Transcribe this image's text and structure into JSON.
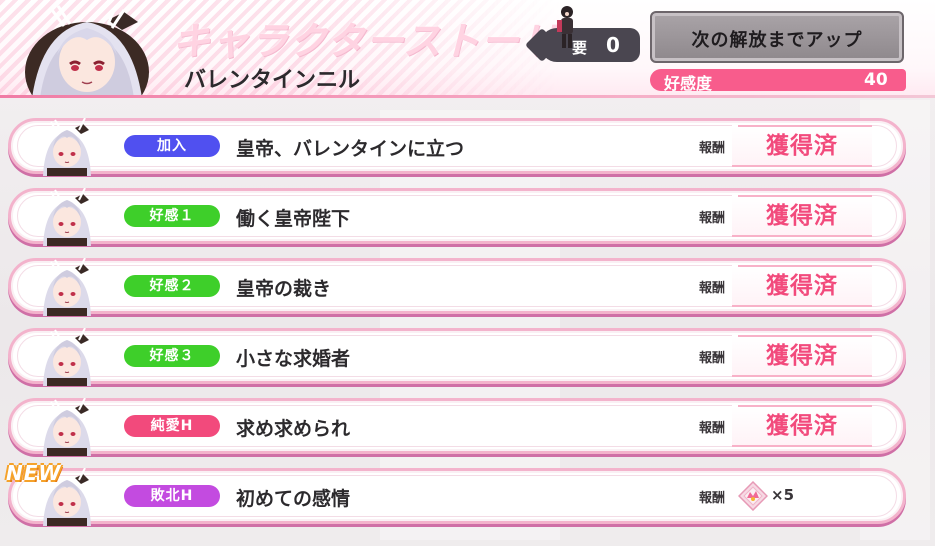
{
  "header": {
    "title": "キャラクターストーリー",
    "character_name": "バレンタインニル",
    "key": {
      "label": "要",
      "count": "0"
    },
    "unlock_button_label": "次の解放までアップ",
    "affinity": {
      "label": "好感度",
      "value": "40"
    }
  },
  "reward_label": "報酬",
  "obtained_text": "獲得済",
  "new_badge": "NEW",
  "colors": {
    "accent_pink": "#f85c8c",
    "tag_join": "#5050f0",
    "tag_affection": "#3ecf2a",
    "tag_love": "#f24a7c",
    "tag_defeat": "#c34be0"
  },
  "stories": [
    {
      "tag": "加入",
      "tag_color": "#5050f0",
      "title": "皇帝、バレンタインに立つ",
      "obtained": true
    },
    {
      "tag": "好感１",
      "tag_color": "#3ecf2a",
      "title": "働く皇帝陛下",
      "obtained": true
    },
    {
      "tag": "好感２",
      "tag_color": "#3ecf2a",
      "title": "皇帝の裁き",
      "obtained": true
    },
    {
      "tag": "好感３",
      "tag_color": "#3ecf2a",
      "title": "小さな求婚者",
      "obtained": true
    },
    {
      "tag": "純愛H",
      "tag_color": "#f24a7c",
      "title": "求め求められ",
      "obtained": true
    },
    {
      "tag": "敗北H",
      "tag_color": "#c34be0",
      "title": "初めての感情",
      "obtained": false,
      "reward": {
        "icon": "gem-icon",
        "count": "×5"
      }
    }
  ]
}
